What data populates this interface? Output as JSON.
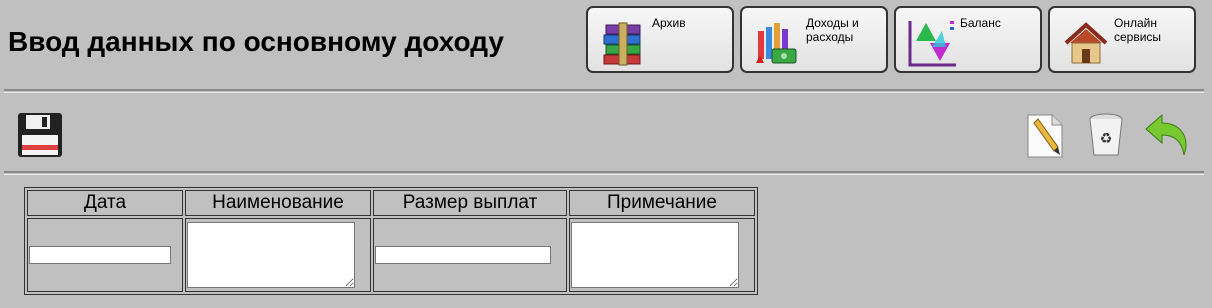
{
  "header": {
    "title": "Ввод данных по основному доходу"
  },
  "nav": [
    {
      "label": "Архив",
      "icon": "archive-books-icon"
    },
    {
      "label": "Доходы и расходы",
      "icon": "income-expenses-icon"
    },
    {
      "label": "Баланс",
      "icon": "balance-chart-icon"
    },
    {
      "label": "Онлайн сервисы",
      "icon": "house-icon"
    }
  ],
  "toolbar": {
    "save_icon": "floppy-disk-icon",
    "new_icon": "pencil-document-icon",
    "delete_icon": "trash-recycle-icon",
    "back_icon": "green-back-arrow-icon"
  },
  "table": {
    "columns": [
      "Дата",
      "Наименование",
      "Размер выплат",
      "Примечание"
    ],
    "row": {
      "date": "",
      "name": "",
      "amount": "",
      "note": ""
    }
  }
}
